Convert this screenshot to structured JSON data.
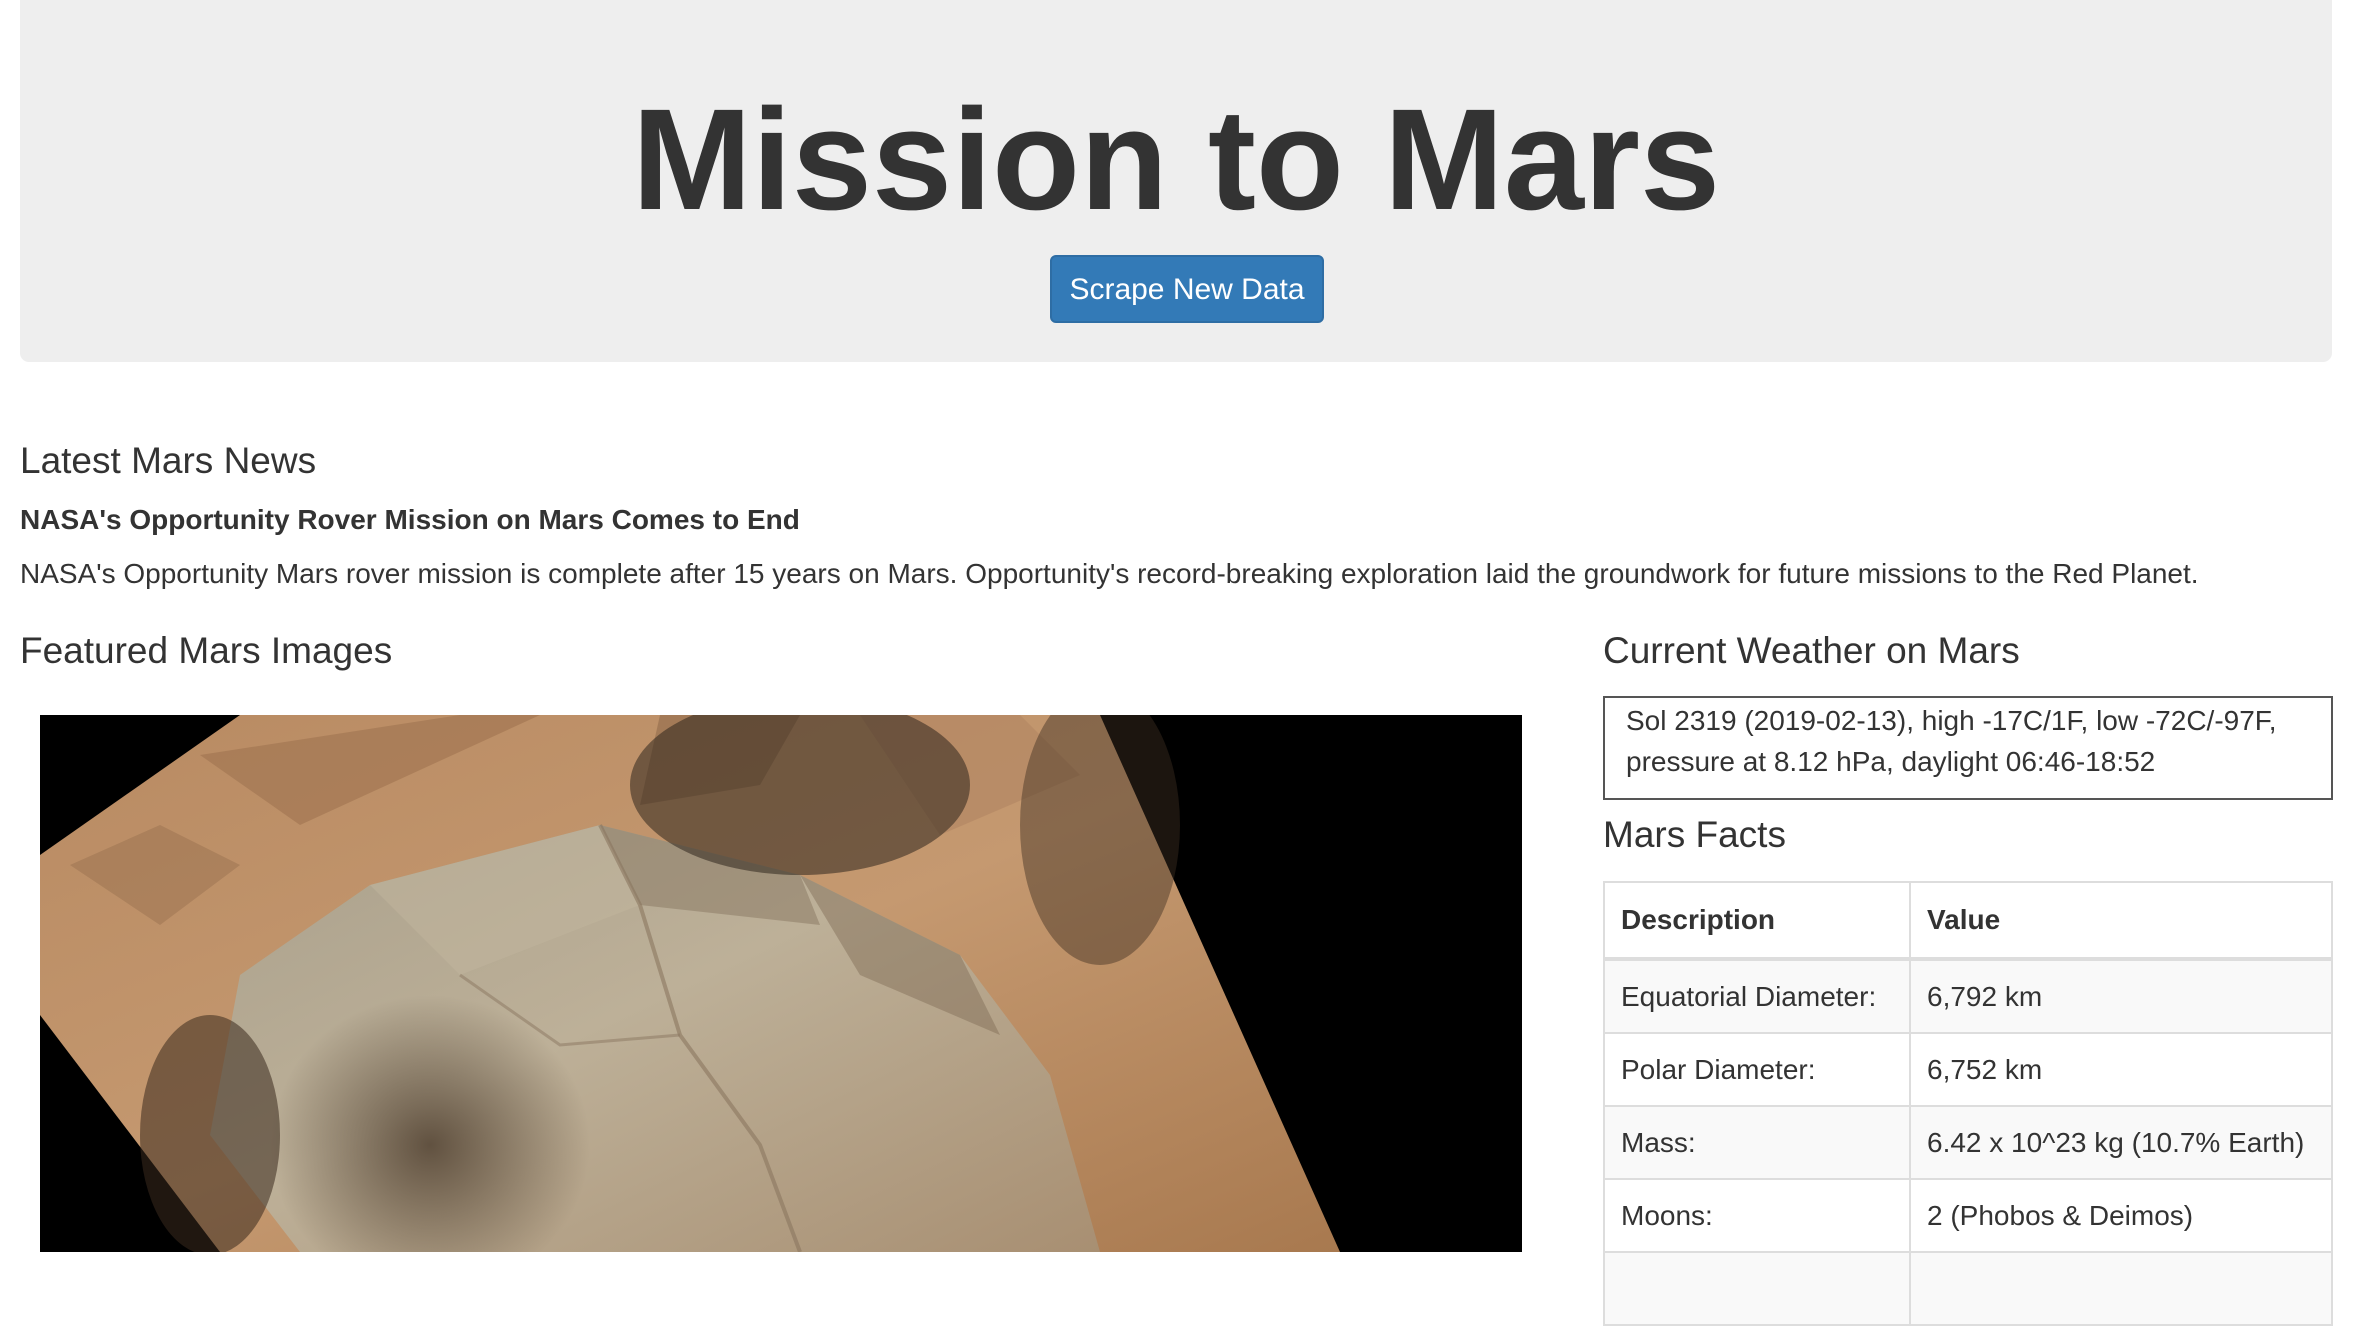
{
  "header": {
    "title": "Mission to Mars",
    "scrape_button_label": "Scrape New Data"
  },
  "news": {
    "heading": "Latest Mars News",
    "title": "NASA's Opportunity Rover Mission on Mars Comes to End",
    "paragraph": "NASA's Opportunity Mars rover mission is complete after 15 years on Mars. Opportunity's record-breaking exploration laid the groundwork for future missions to the Red Planet."
  },
  "featured_images": {
    "heading": "Featured Mars Images"
  },
  "weather": {
    "heading": "Current Weather on Mars",
    "line1": "Sol 2319 (2019-02-13), high -17C/1F, low -72C/-97F,",
    "line2": "pressure at 8.12 hPa, daylight 06:46-18:52"
  },
  "facts": {
    "heading": "Mars Facts",
    "columns": [
      "Description",
      "Value"
    ],
    "rows": [
      {
        "description": "Equatorial Diameter:",
        "value": "6,792 km"
      },
      {
        "description": "Polar Diameter:",
        "value": "6,752 km"
      },
      {
        "description": "Mass:",
        "value": "6.42 x 10^23 kg (10.7% Earth)"
      },
      {
        "description": "Moons:",
        "value": "2 (Phobos & Deimos)"
      },
      {
        "description": "",
        "value": ""
      }
    ]
  },
  "colors": {
    "jumbotron_bg": "#eeeeee",
    "primary_button": "#337ab7",
    "text": "#333333"
  }
}
